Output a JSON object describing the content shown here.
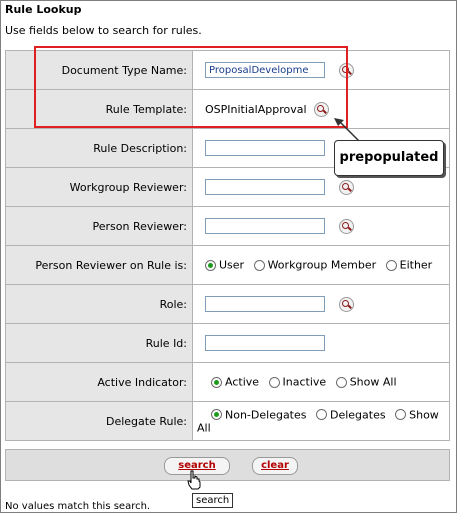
{
  "page": {
    "title": "Rule Lookup",
    "subtitle": "Use fields below to search for rules."
  },
  "fields": {
    "doc_type": {
      "label": "Document Type Name:",
      "value": "ProposalDevelopme"
    },
    "rule_template": {
      "label": "Rule Template:",
      "value": "OSPInitialApproval"
    },
    "rule_description": {
      "label": "Rule Description:",
      "value": ""
    },
    "workgroup_reviewer": {
      "label": "Workgroup Reviewer:",
      "value": ""
    },
    "person_reviewer": {
      "label": "Person Reviewer:",
      "value": ""
    },
    "person_reviewer_on_rule": {
      "label": "Person Reviewer on Rule is:",
      "options": [
        "User",
        "Workgroup Member",
        "Either"
      ],
      "selected": "User"
    },
    "role": {
      "label": "Role:",
      "value": ""
    },
    "rule_id": {
      "label": "Rule Id:",
      "value": ""
    },
    "active_indicator": {
      "label": "Active Indicator:",
      "options": [
        "Active",
        "Inactive",
        "Show All"
      ],
      "selected": "Active"
    },
    "delegate_rule": {
      "label": "Delegate Rule:",
      "options": [
        "Non-Delegates",
        "Delegates",
        "Show All"
      ],
      "selected": "Non-Delegates"
    }
  },
  "buttons": {
    "search": "search",
    "clear": "clear"
  },
  "annotations": {
    "callout": "prepopulated",
    "tooltip": "search"
  },
  "footer": {
    "text": "No values match this search."
  },
  "colors": {
    "highlight_box": "#e02020",
    "button_text": "#b20000",
    "label_bg": "#e6e6e6"
  },
  "icons": [
    "magnifier-lookup-icon",
    "pointer-hand-cursor-icon"
  ]
}
